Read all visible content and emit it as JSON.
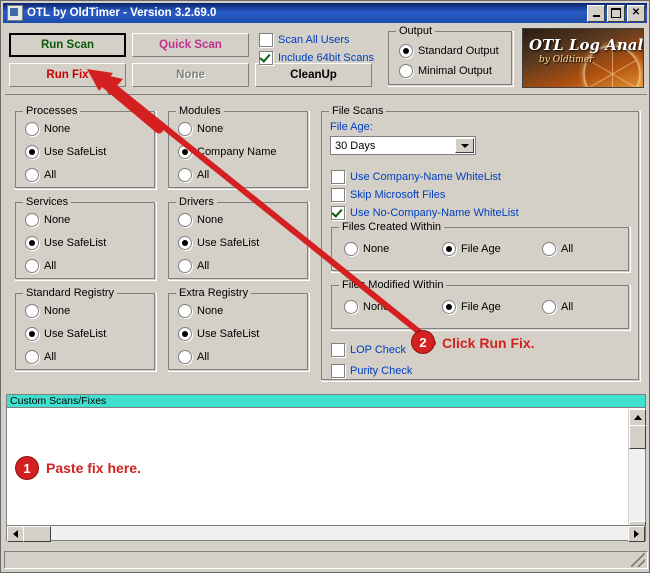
{
  "window": {
    "title": "OTL by OldTimer - Version 3.2.69.0",
    "icon": "app-icon",
    "buttons": {
      "minimize": "minimize-icon",
      "maximize": "maximize-icon",
      "close": "close-icon"
    }
  },
  "toolbar": {
    "run_scan": "Run Scan",
    "quick_scan": "Quick Scan",
    "run_fix": "Run Fix",
    "none_button": "None",
    "cleanup": "CleanUp",
    "scan_all_users": "Scan All Users",
    "include_64bit": "Include 64bit Scans"
  },
  "output": {
    "title": "Output",
    "standard": "Standard Output",
    "minimal": "Minimal Output",
    "selected": "Standard Output"
  },
  "logo": {
    "line1": "OTL Log Analysis",
    "line2": "by Oldtimer"
  },
  "groups": {
    "processes": {
      "title": "Processes",
      "options": [
        "None",
        "Use SafeList",
        "All"
      ],
      "selected": "Use SafeList"
    },
    "modules": {
      "title": "Modules",
      "options": [
        "None",
        "Company Name",
        "All"
      ],
      "selected": "Company Name"
    },
    "services": {
      "title": "Services",
      "options": [
        "None",
        "Use SafeList",
        "All"
      ],
      "selected": "Use SafeList"
    },
    "drivers": {
      "title": "Drivers",
      "options": [
        "None",
        "Use SafeList",
        "All"
      ],
      "selected": "Use SafeList"
    },
    "standard_registry": {
      "title": "Standard Registry",
      "options": [
        "None",
        "Use SafeList",
        "All"
      ],
      "selected": "Use SafeList"
    },
    "extra_registry": {
      "title": "Extra Registry",
      "options": [
        "None",
        "Use SafeList",
        "All"
      ],
      "selected": "Use SafeList"
    }
  },
  "file_scans": {
    "title": "File Scans",
    "file_age_label": "File Age:",
    "file_age_value": "30 Days",
    "checks": [
      {
        "label": "Use Company-Name WhiteList",
        "checked": false
      },
      {
        "label": "Skip Microsoft Files",
        "checked": false
      },
      {
        "label": "Use No-Company-Name WhiteList",
        "checked": true
      }
    ],
    "created_within": {
      "title": "Files Created Within",
      "options": [
        "None",
        "File Age",
        "All"
      ],
      "selected": "File Age"
    },
    "modified_within": {
      "title": "Files Modified Within",
      "options": [
        "None",
        "File Age",
        "All"
      ],
      "selected": "File Age"
    },
    "lop_check": "LOP Check",
    "purity_check": "Purity Check",
    "lop_checked": false,
    "purity_checked": false
  },
  "custom_scans": {
    "header": "Custom Scans/Fixes",
    "content": ""
  },
  "annotations": {
    "step1": {
      "number": "1",
      "text": "Paste fix here."
    },
    "step2": {
      "number": "2",
      "text": "Click Run Fix."
    },
    "arrow_color": "#d42020"
  }
}
